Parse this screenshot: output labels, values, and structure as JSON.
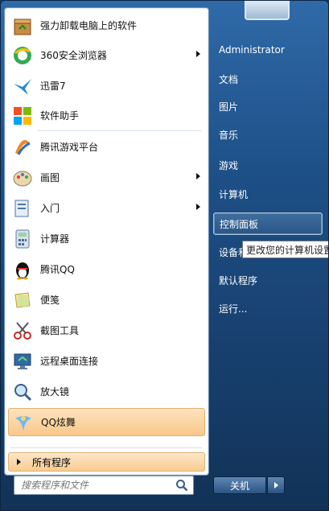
{
  "programs": [
    {
      "label": "强力卸载电脑上的软件",
      "icon": "uninstall-box-icon",
      "arrow": false,
      "highlight": false
    },
    {
      "label": "360安全浏览器",
      "icon": "360-browser-icon",
      "arrow": true,
      "highlight": false
    },
    {
      "label": "迅雷7",
      "icon": "thunder-bird-icon",
      "arrow": false,
      "highlight": false
    },
    {
      "label": "软件助手",
      "icon": "software-assistant-icon",
      "arrow": false,
      "highlight": false
    },
    {
      "label": "腾讯游戏平台",
      "icon": "tencent-game-icon",
      "arrow": false,
      "highlight": false
    },
    {
      "label": "画图",
      "icon": "paint-palette-icon",
      "arrow": true,
      "highlight": false
    },
    {
      "label": "入门",
      "icon": "getting-started-icon",
      "arrow": true,
      "highlight": false
    },
    {
      "label": "计算器",
      "icon": "calculator-icon",
      "arrow": false,
      "highlight": false
    },
    {
      "label": "腾讯QQ",
      "icon": "qq-penguin-icon",
      "arrow": false,
      "highlight": false
    },
    {
      "label": "便笺",
      "icon": "sticky-notes-icon",
      "arrow": false,
      "highlight": false
    },
    {
      "label": "截图工具",
      "icon": "scissors-icon",
      "arrow": false,
      "highlight": false
    },
    {
      "label": "远程桌面连接",
      "icon": "remote-desktop-icon",
      "arrow": false,
      "highlight": false
    },
    {
      "label": "放大镜",
      "icon": "magnifier-icon",
      "arrow": false,
      "highlight": false
    },
    {
      "label": "QQ炫舞",
      "icon": "qq-dance-icon",
      "arrow": false,
      "highlight": true
    }
  ],
  "all_programs": "所有程序",
  "search": {
    "placeholder": "搜索程序和文件"
  },
  "right_items": [
    {
      "label": "Administrator",
      "active": false
    },
    {
      "label": "文档",
      "active": false
    },
    {
      "label": "图片",
      "active": false
    },
    {
      "label": "音乐",
      "active": false
    },
    {
      "label": "游戏",
      "active": false
    },
    {
      "label": "计算机",
      "active": false
    },
    {
      "label": "控制面板",
      "active": true
    },
    {
      "label": "设备和",
      "active": false
    },
    {
      "label": "默认程序",
      "active": false
    },
    {
      "label": "运行...",
      "active": false
    }
  ],
  "tooltip": "更改您的计算机设置",
  "shutdown": "关机",
  "colors": {
    "highlight": "#f9c889",
    "panel": "#1d4f86"
  }
}
